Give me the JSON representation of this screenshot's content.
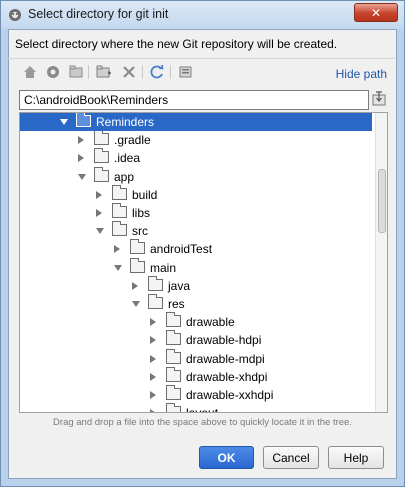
{
  "window": {
    "title": "Select directory for git init",
    "close_label": "✕"
  },
  "description": "Select directory where the new Git repository will be created.",
  "toolbar": {
    "icons": [
      "home-icon",
      "project-icon",
      "module-icon",
      "new-folder-icon",
      "delete-icon",
      "refresh-icon",
      "show-hidden-icon"
    ],
    "hide_path_label": "Hide path"
  },
  "path_field": {
    "value": "C:\\androidBook\\Reminders"
  },
  "tree": {
    "items": [
      {
        "label": "Reminders",
        "level": 0,
        "expanded": true,
        "selected": true
      },
      {
        "label": ".gradle",
        "level": 1,
        "expanded": false,
        "selected": false
      },
      {
        "label": ".idea",
        "level": 1,
        "expanded": false,
        "selected": false
      },
      {
        "label": "app",
        "level": 1,
        "expanded": true,
        "selected": false
      },
      {
        "label": "build",
        "level": 2,
        "expanded": false,
        "selected": false
      },
      {
        "label": "libs",
        "level": 2,
        "expanded": false,
        "selected": false
      },
      {
        "label": "src",
        "level": 2,
        "expanded": true,
        "selected": false
      },
      {
        "label": "androidTest",
        "level": 3,
        "expanded": false,
        "selected": false
      },
      {
        "label": "main",
        "level": 3,
        "expanded": true,
        "selected": false
      },
      {
        "label": "java",
        "level": 4,
        "expanded": false,
        "selected": false
      },
      {
        "label": "res",
        "level": 4,
        "expanded": true,
        "selected": false
      },
      {
        "label": "drawable",
        "level": 5,
        "expanded": false,
        "selected": false
      },
      {
        "label": "drawable-hdpi",
        "level": 5,
        "expanded": false,
        "selected": false
      },
      {
        "label": "drawable-mdpi",
        "level": 5,
        "expanded": false,
        "selected": false
      },
      {
        "label": "drawable-xhdpi",
        "level": 5,
        "expanded": false,
        "selected": false
      },
      {
        "label": "drawable-xxhdpi",
        "level": 5,
        "expanded": false,
        "selected": false
      },
      {
        "label": "layout",
        "level": 5,
        "expanded": false,
        "selected": false
      }
    ]
  },
  "hint": "Drag and drop a file into the space above to quickly locate it in the tree.",
  "buttons": {
    "ok": "OK",
    "cancel": "Cancel",
    "help": "Help"
  },
  "colors": {
    "selection": "#2a68c8",
    "link": "#1f55a8",
    "ok_button": "#2a68d2"
  }
}
